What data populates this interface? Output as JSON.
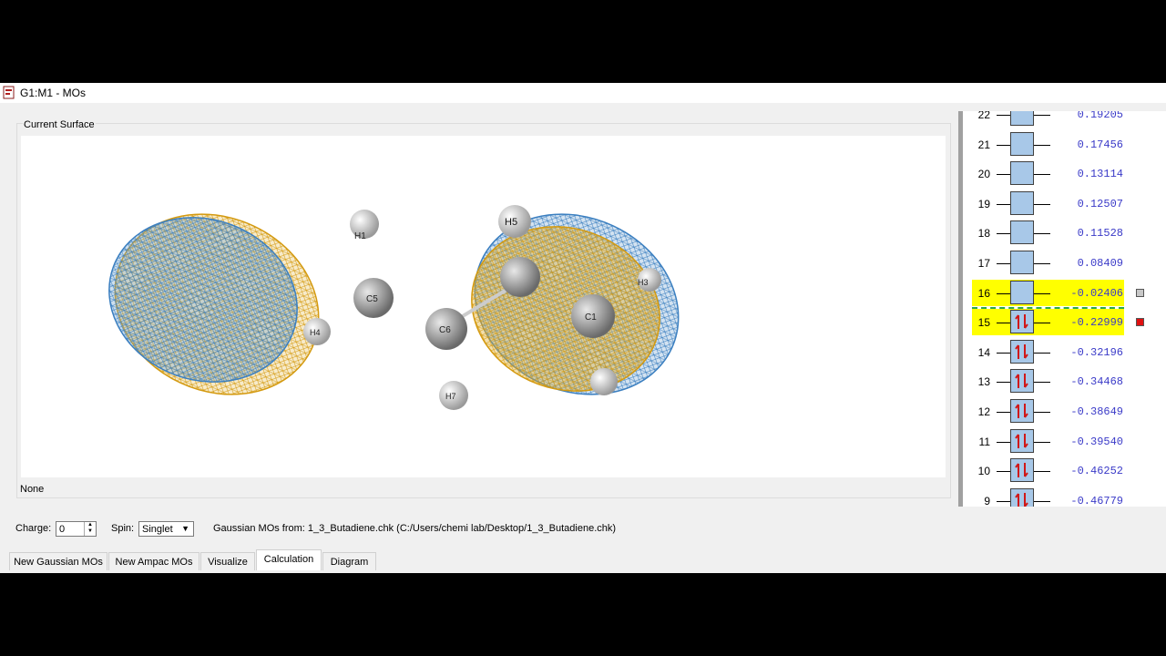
{
  "window": {
    "title": "G1:M1 - MOs"
  },
  "surface": {
    "group_label": "Current Surface",
    "status": "None",
    "atoms": [
      "H5",
      "C1",
      "H3",
      "C5",
      "C6",
      "H4",
      "H1",
      "H7"
    ]
  },
  "mo_levels": [
    {
      "num": "22",
      "energy": "0.19205",
      "occupied": false
    },
    {
      "num": "21",
      "energy": "0.17456",
      "occupied": false
    },
    {
      "num": "20",
      "energy": "0.13114",
      "occupied": false
    },
    {
      "num": "19",
      "energy": "0.12507",
      "occupied": false
    },
    {
      "num": "18",
      "energy": "0.11528",
      "occupied": false
    },
    {
      "num": "17",
      "energy": "0.08409",
      "occupied": false
    },
    {
      "num": "16",
      "energy": "-0.02406",
      "occupied": false,
      "highlight": true,
      "marker_color": "#c8c8c8"
    },
    {
      "num": "15",
      "energy": "-0.22999",
      "occupied": true,
      "highlight": true,
      "marker_color": "#e01010"
    },
    {
      "num": "14",
      "energy": "-0.32196",
      "occupied": true
    },
    {
      "num": "13",
      "energy": "-0.34468",
      "occupied": true
    },
    {
      "num": "12",
      "energy": "-0.38649",
      "occupied": true
    },
    {
      "num": "11",
      "energy": "-0.39540",
      "occupied": true
    },
    {
      "num": "10",
      "energy": "-0.46252",
      "occupied": true
    },
    {
      "num": "9",
      "energy": "-0.46779",
      "occupied": true
    }
  ],
  "controls": {
    "charge_label": "Charge:",
    "charge_value": "0",
    "spin_label": "Spin:",
    "spin_value": "Singlet",
    "source_text": "Gaussian MOs from:  1_3_Butadiene.chk (C:/Users/chemi lab/Desktop/1_3_Butadiene.chk)"
  },
  "tabs": [
    {
      "label": "New Gaussian MOs",
      "active": false
    },
    {
      "label": "New Ampac MOs",
      "active": false
    },
    {
      "label": "Visualize",
      "active": false
    },
    {
      "label": "Calculation",
      "active": true
    },
    {
      "label": "Diagram",
      "active": false
    }
  ],
  "colors": {
    "lobe_blue": "#6fa3d2",
    "lobe_gold": "#e0b030",
    "highlight": "#ffff00",
    "unoccupied_box": "#a8c8e8"
  }
}
